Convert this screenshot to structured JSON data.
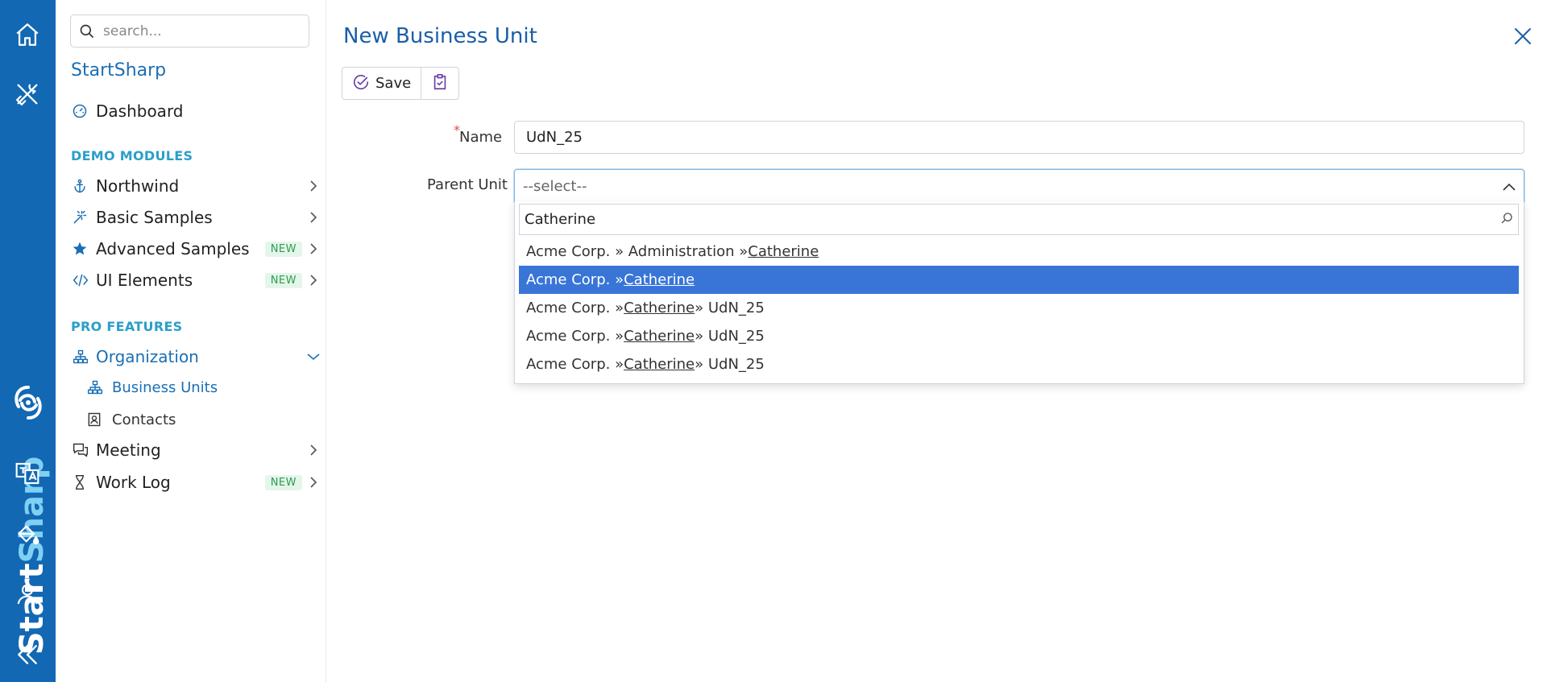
{
  "brand": {
    "start": "Start",
    "sharp": "Sharp"
  },
  "sidebar": {
    "search_placeholder": "search...",
    "app_title": "StartSharp",
    "dashboard": "Dashboard",
    "section_demo": "DEMO MODULES",
    "section_pro": "PRO FEATURES",
    "items": [
      {
        "label": "Northwind"
      },
      {
        "label": "Basic Samples"
      },
      {
        "label": "Advanced Samples",
        "badge": "NEW"
      },
      {
        "label": "UI Elements",
        "badge": "NEW"
      },
      {
        "label": "Organization"
      },
      {
        "label": "Meeting"
      },
      {
        "label": "Work Log",
        "badge": "NEW"
      }
    ],
    "sub_items": [
      {
        "label": "Business Units"
      },
      {
        "label": "Contacts"
      }
    ]
  },
  "main": {
    "title": "New Business Unit",
    "toolbar": {
      "save_label": "Save"
    },
    "form": {
      "name_label": "Name",
      "required_mark": "*",
      "name_value": "UdN_25",
      "parent_label": "Parent Unit",
      "parent_placeholder": "--select--",
      "dropdown_search_value": "Catherine",
      "options": [
        {
          "before": "Acme Corp. » Administration » ",
          "match": "Catherine",
          "after": ""
        },
        {
          "before": "Acme Corp. » ",
          "match": "Catherine",
          "after": ""
        },
        {
          "before": "Acme Corp. » ",
          "match": "Catherine",
          "after": " » UdN_25"
        },
        {
          "before": "Acme Corp. » ",
          "match": "Catherine",
          "after": " » UdN_25"
        },
        {
          "before": "Acme Corp. » ",
          "match": "Catherine",
          "after": " » UdN_25"
        }
      ],
      "selected_option_index": 1
    }
  },
  "colors": {
    "rail": "#1268b3",
    "accent": "#1a6fb4",
    "selected_option": "#3875d7",
    "new_badge": "#2f9b52"
  }
}
